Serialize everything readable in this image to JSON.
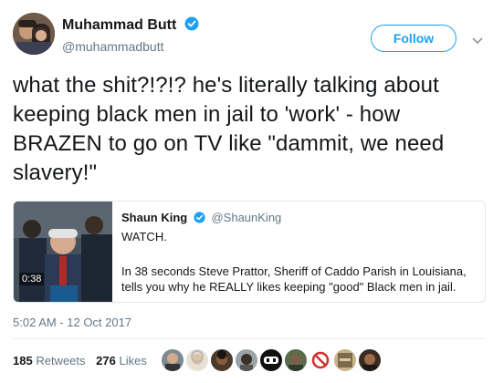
{
  "author": {
    "display_name": "Muhammad Butt",
    "handle": "@muhammadbutt",
    "verified_icon": "verified-badge-icon"
  },
  "follow_button": {
    "label": "Follow"
  },
  "tweet": {
    "text": "what the shit?!?!? he's literally talking about keeping black men in jail to 'work' - how BRAZEN to go on TV like \"dammit, we need slavery!\""
  },
  "quoted_tweet": {
    "display_name": "Shaun King",
    "handle": "@ShaunKing",
    "line1": "WATCH.",
    "body": "In 38 seconds Steve Prattor, Sheriff of Caddo Parish in Louisiana, tells you why he REALLY likes keeping \"good\" Black men in jail.",
    "video_duration": "0:38"
  },
  "timestamp": "5:02 AM - 12 Oct 2017",
  "stats": {
    "retweets_count": "185",
    "retweets_label": "Retweets",
    "likes_count": "276",
    "likes_label": "Likes"
  },
  "colors": {
    "accent": "#1da1f2",
    "secondary_text": "#657786",
    "border": "#e1e8ed"
  }
}
